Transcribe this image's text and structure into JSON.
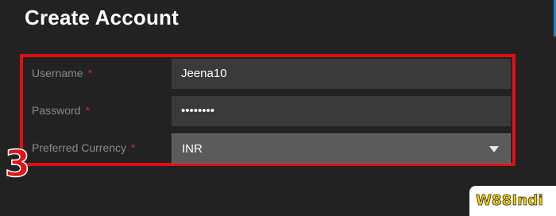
{
  "page": {
    "title": "Create Account"
  },
  "form": {
    "username": {
      "label": "Username",
      "required_mark": "*",
      "value": "Jeena10"
    },
    "password": {
      "label": "Password",
      "required_mark": "*",
      "value": "••••••••"
    },
    "currency": {
      "label": "Preferred Currency",
      "required_mark": "*",
      "selected": "INR",
      "icon": "chevron-down-icon"
    }
  },
  "annotation": {
    "step_number": "3",
    "highlight_color": "#e10f13"
  },
  "watermark": {
    "text": "W88Indi"
  },
  "colors": {
    "background": "#222222",
    "field_background": "#3a3a3a",
    "select_background": "#5b5b5b",
    "label": "#8a8a8a",
    "required": "#d0262b",
    "watermark_text": "#ffd400"
  }
}
